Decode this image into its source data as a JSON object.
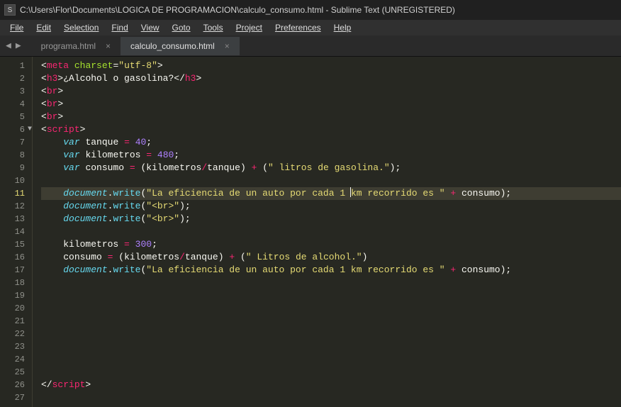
{
  "titlebar": {
    "icon_letter": "S",
    "path": "C:\\Users\\Flor\\Documents\\LOGICA DE PROGRAMACION\\calculo_consumo.html - Sublime Text (UNREGISTERED)"
  },
  "menu": {
    "items": [
      "File",
      "Edit",
      "Selection",
      "Find",
      "View",
      "Goto",
      "Tools",
      "Project",
      "Preferences",
      "Help"
    ]
  },
  "nav": {
    "left": "◀",
    "right": "▶"
  },
  "tabs": [
    {
      "name": "programa.html",
      "active": false
    },
    {
      "name": "calculo_consumo.html",
      "active": true
    }
  ],
  "close_glyph": "×",
  "fold_glyph": "▼",
  "gutter": {
    "from": 1,
    "to": 27,
    "highlight": 11
  },
  "code": {
    "l1": {
      "meta": "meta",
      "attr": "charset",
      "eq": "=",
      "val": "\"utf-8\""
    },
    "l2": {
      "h3": "h3",
      "text": "¿Alcohol o gasolina?"
    },
    "l3": {
      "br": "br"
    },
    "l4": {
      "br": "br"
    },
    "l5": {
      "br": "br"
    },
    "l6": {
      "script": "script"
    },
    "l7": {
      "var": "var",
      "name": "tanque",
      "eq": "=",
      "num": "40",
      "semi": ";"
    },
    "l8": {
      "var": "var",
      "name": "kilometros",
      "eq": "=",
      "num": "480",
      "semi": ";"
    },
    "l9": {
      "var": "var",
      "name": "consumo",
      "eq": "=",
      "a": "kilometros",
      "div": "/",
      "b": "tanque",
      "plus": "+",
      "str": "\" litros de gasolina.\"",
      "semi": ";"
    },
    "l11": {
      "obj": "document",
      "dot": ".",
      "fn": "write",
      "str1": "\"La eficiencia de un auto por cada 1 ",
      "str2": "km recorrido es \"",
      "plus": "+",
      "v": "consumo",
      "semi": ";"
    },
    "l12": {
      "obj": "document",
      "dot": ".",
      "fn": "write",
      "str": "\"<br>\"",
      "semi": ";"
    },
    "l13": {
      "obj": "document",
      "dot": ".",
      "fn": "write",
      "str": "\"<br>\"",
      "semi": ";"
    },
    "l15": {
      "name": "kilometros",
      "eq": "=",
      "num": "300",
      "semi": ";"
    },
    "l16": {
      "name": "consumo",
      "eq": "=",
      "a": "kilometros",
      "div": "/",
      "b": "tanque",
      "plus": "+",
      "str": "\" Litros de alcohol.\""
    },
    "l17": {
      "obj": "document",
      "dot": ".",
      "fn": "write",
      "str": "\"La eficiencia de un auto por cada 1 km recorrido es \"",
      "plus": "+",
      "v": "consumo",
      "semi": ";"
    },
    "l26": {
      "script": "script"
    }
  }
}
